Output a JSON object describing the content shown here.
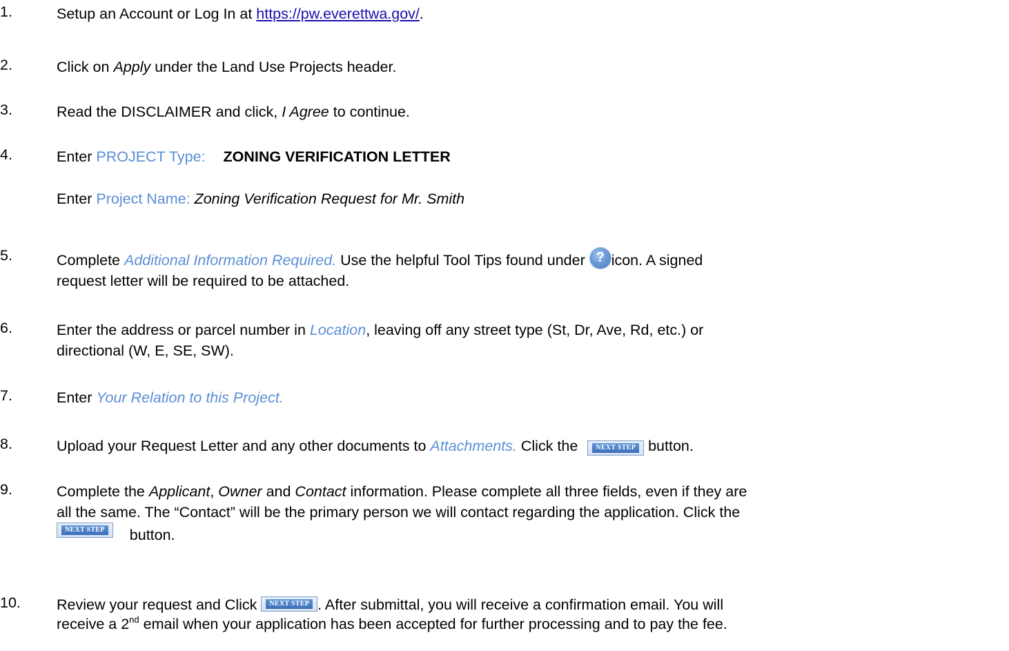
{
  "steps": [
    {
      "num": "1.",
      "pre": "Setup an Account or Log In at ",
      "link": "https://pw.everettwa.gov/",
      "post": "."
    },
    {
      "num": "2.",
      "pre": "Click on ",
      "em": "Apply",
      "post": " under the Land Use Projects header."
    },
    {
      "num": "3.",
      "pre": "Read the DISCLAIMER and click, ",
      "em": "I Agree",
      "post": " to continue."
    },
    {
      "num": "4.",
      "pre": "Enter ",
      "field": "PROJECT Type:",
      "value": "ZONING VERIFICATION LETTER"
    },
    {
      "pre": "Enter ",
      "field": "Project Name:",
      "value": "Zoning Verification Request for Mr. Smith"
    },
    {
      "num": "5.",
      "pre": "Complete ",
      "em": "Additional Information Required.",
      "mid": " Use the helpful Tool Tips found under ",
      "icon_text": "?",
      "post": "icon. A signed",
      "line2": "request letter will be required to be attached."
    },
    {
      "num": "6.",
      "pre": "Enter the address or parcel number in ",
      "em": "Location",
      "post": ", leaving off any street type (St, Dr, Ave, Rd, etc.) or",
      "line2": "directional (W, E, SE, SW)."
    },
    {
      "num": "7.",
      "pre": "Enter ",
      "em": "Your Relation to this Project."
    },
    {
      "num": "8.",
      "pre": "Upload your Request Letter and any other documents to ",
      "em": "Attachments.",
      "mid": " Click the ",
      "post": " button."
    },
    {
      "num": "9.",
      "pre": "Complete the ",
      "em1": "Applicant",
      "sep1": ", ",
      "em2": "Owner",
      "sep2": " and ",
      "em3": "Contact",
      "post": " information. Please complete all three fields, even if they are",
      "line2": "all the same. The “Contact” will be the primary person we will contact regarding the application. Click the",
      "line3": " button."
    },
    {
      "num": "10.",
      "pre": "Review your request and Click ",
      "post": ". After submittal, you will receive a confirmation email. You will",
      "line2a": "receive a 2",
      "sup": "nd",
      "line2b": " email when your application has been accepted for further processing and to pay the fee."
    }
  ],
  "button": {
    "label": "NEXT STEP"
  },
  "icons": {
    "help": "help-question-icon",
    "button": "next-step-button"
  },
  "colors": {
    "field_label": "#5b8ed6",
    "link": "#1a0dab"
  }
}
